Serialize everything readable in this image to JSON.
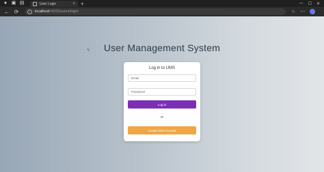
{
  "browser": {
    "tab_title": "User Login",
    "tab_close": "×",
    "new_tab": "+",
    "url_host": "localhost",
    "url_path": ":5003/users/login",
    "back": "←",
    "reload": "⟳",
    "win_min": "—",
    "win_max": "☐",
    "win_close": "✕",
    "star": "☆",
    "menu": "⋯"
  },
  "page": {
    "app_title": "User Management System",
    "card_title": "Log in to UMS",
    "email_placeholder": "Email",
    "password_placeholder": "Password",
    "login_button": "Log in",
    "or_text": "or",
    "create_button": "Create New Account"
  },
  "colors": {
    "login_button": "#7b2fb5",
    "create_button": "#f0a645"
  }
}
